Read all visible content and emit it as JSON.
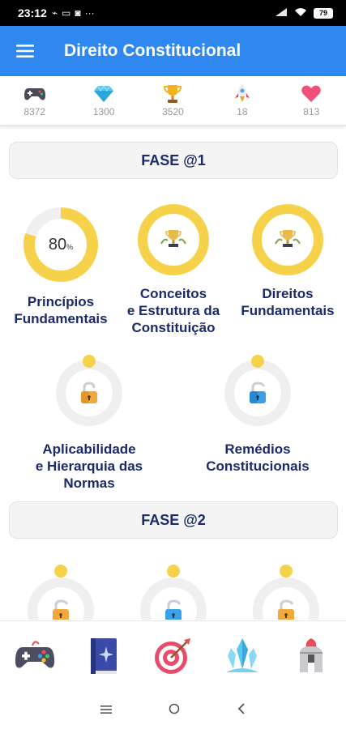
{
  "status_bar": {
    "time": "23:12",
    "battery": "79"
  },
  "app_bar": {
    "title": "Direito Constitucional"
  },
  "stats": [
    {
      "icon": "gamepad-icon",
      "value": "8372"
    },
    {
      "icon": "diamond-icon",
      "value": "1300"
    },
    {
      "icon": "trophy-icon",
      "value": "3520"
    },
    {
      "icon": "rocket-icon",
      "value": "18"
    },
    {
      "icon": "heart-icon",
      "value": "813"
    }
  ],
  "phases": [
    {
      "title": "FASE @1",
      "lessons": [
        {
          "label_lines": [
            "Princípios",
            "Fundamentais"
          ],
          "state": "in-progress",
          "progress": "80",
          "progress_unit": "%"
        },
        {
          "label_lines": [
            "Conceitos",
            "e Estrutura da",
            "Constituição"
          ],
          "state": "completed",
          "icon": "trophy-icon"
        },
        {
          "label_lines": [
            "Direitos",
            "Fundamentais"
          ],
          "state": "completed",
          "icon": "trophy-icon"
        },
        {
          "label_lines": [
            "Aplicabilidade",
            "e Hierarquia das",
            "Normas"
          ],
          "state": "locked",
          "icon": "padlock-icon"
        },
        {
          "label_lines": [
            "Remédios",
            "Constitucionais"
          ],
          "state": "locked",
          "icon": "padlock-icon"
        }
      ]
    },
    {
      "title": "FASE @2",
      "lessons": [
        {
          "state": "locked",
          "icon": "padlock-icon"
        },
        {
          "state": "locked",
          "icon": "padlock-icon"
        },
        {
          "state": "locked",
          "icon": "padlock-icon"
        }
      ]
    }
  ],
  "bottom_nav": [
    {
      "icon": "gamepad-icon"
    },
    {
      "icon": "book-icon"
    },
    {
      "icon": "target-icon"
    },
    {
      "icon": "crystal-icon"
    },
    {
      "icon": "spartan-helmet-icon"
    }
  ],
  "colors": {
    "primary": "#2f88f0",
    "accent_gold": "#f6d24a",
    "text_navy": "#1b2a6b"
  }
}
